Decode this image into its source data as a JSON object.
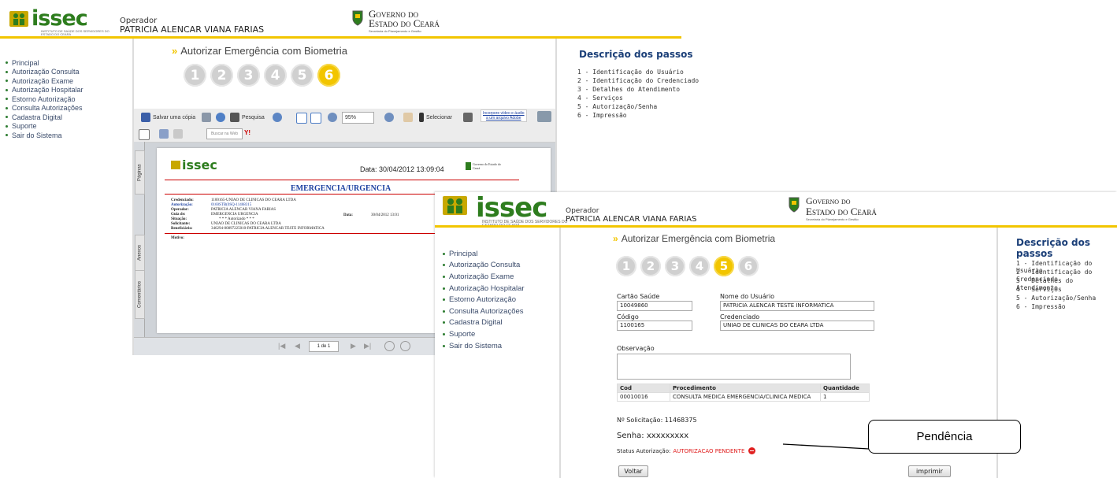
{
  "back_screen": {
    "logo": {
      "text": "issec",
      "subtitle": "INSTITUTO DE SAÚDE DOS SERVIDORES DO ESTADO DO CEARÁ"
    },
    "operator": {
      "label": "Operador",
      "name": "PATRICIA ALENCAR VIANA FARIAS"
    },
    "government": {
      "line1": "Governo do",
      "line2": "Estado do Ceará",
      "sub": "Secretaria do Planejamento e Gestão"
    },
    "menu": [
      "Principal",
      "Autorização Consulta",
      "Autorização Exame",
      "Autorização Hospitalar",
      "Estorno Autorização",
      "Consulta Autorizações",
      "Cadastra Digital",
      "Suporte",
      "Sair do Sistema"
    ],
    "page_title": "Autorizar Emergência com Biometria",
    "steps": [
      "1",
      "2",
      "3",
      "4",
      "5",
      "6"
    ],
    "active_step": 6,
    "desc_title": "Descrição dos passos",
    "desc_steps": [
      "1 - Identificação do Usuário",
      "2 - Identificação do Credenciado",
      "3 - Detalhes do Atendimento",
      "4 - Serviços",
      "5 - Autorização/Senha",
      "6 - Impressão"
    ],
    "pdf_toolbar": {
      "save": "Salvar uma cópia",
      "search": "Pesquisa",
      "zoom": "95%",
      "select": "Selecionar",
      "adobe_line1": "Incorpore vídeo e áudio",
      "adobe_line2": "a um arquivo Adobe",
      "web_search": "Buscar na Web",
      "yahoo": "Y!"
    },
    "pdf_side_tabs": [
      "Páginas",
      "Anexos",
      "Comentários"
    ],
    "pdf_nav": {
      "page": "1 de 1"
    },
    "pdf_doc": {
      "logo": "issec",
      "date": "Data: 30/04/2012 13:09:04",
      "gov": "Governo do Estado do Ceará",
      "heading": "EMERGENCIA/URGENCIA",
      "rows": [
        {
          "label": "Credenciado:",
          "value": "1100165-UNIAO DE CLINICAS DO CEARA LTDA"
        },
        {
          "label": "Autorização:",
          "value": "0160STB(0SQ-11468315"
        },
        {
          "label": "Operador:",
          "value": "PATRICIA ALENCAR VIANA FARIAS"
        },
        {
          "label": "Guia de:",
          "value": "EMERGENCIA URGENCIA"
        },
        {
          "label": "Situação:",
          "value": "* * * Autorizado * * *"
        },
        {
          "label": "Solicitante:",
          "value": "UNIAO DE CLINICAS DO CEARA LTDA"
        },
        {
          "label": "Beneficiário:",
          "value": "346294-00897225010-PATRICIA ALENCAR TESTE INFORMATICA"
        }
      ],
      "date_label": "Data:",
      "date_value": "30/04/2012 13:01",
      "motivo": "Motivo:"
    }
  },
  "front_screen": {
    "logo": {
      "text": "issec",
      "subtitle": "INSTITUTO DE SAÚDE DOS SERVIDORES DO ESTADO DO CEARÁ"
    },
    "operator": {
      "label": "Operador",
      "name": "PATRICIA ALENCAR VIANA FARIAS"
    },
    "government": {
      "line1": "Governo do",
      "line2": "Estado do Ceará",
      "sub": "Secretaria do Planejamento e Gestão"
    },
    "menu": [
      "Principal",
      "Autorização Consulta",
      "Autorização Exame",
      "Autorização Hospitalar",
      "Estorno Autorização",
      "Consulta Autorizações",
      "Cadastra Digital",
      "Suporte",
      "Sair do Sistema"
    ],
    "page_title": "Autorizar Emergência com Biometria",
    "steps": [
      "1",
      "2",
      "3",
      "4",
      "5",
      "6"
    ],
    "active_step": 5,
    "desc_title": "Descrição dos passos",
    "desc_steps": [
      "1 - Identificação do Usuário",
      "2 - Identificação do Credenciado",
      "3 - Detalhes do Atendimento",
      "4 - Serviços",
      "5 - Autorização/Senha",
      "6 - Impressão"
    ],
    "form": {
      "cartao_label": "Cartão Saúde",
      "cartao_value": "10049860",
      "nome_label": "Nome do Usuário",
      "nome_value": "PATRICIA ALENCAR TESTE INFORMATICA",
      "codigo_label": "Código",
      "codigo_value": "1100165",
      "credenciado_label": "Credenciado",
      "credenciado_value": "UNIAO DE CLINICAS DO CEARA LTDA",
      "obs_label": "Observação",
      "obs_value": ""
    },
    "table": {
      "headers": [
        "Cod",
        "Procedimento",
        "Quantidade"
      ],
      "rows": [
        [
          "00010016",
          "CONSULTA MEDICA EMERGENCIA/CLINICA MEDICA",
          "1"
        ]
      ]
    },
    "solicitacao": "Nº Solicitação: 11468375",
    "senha": "Senha: xxxxxxxxx",
    "status_label": "Status Autorização:",
    "status_value": "AUTORIZACAO PENDENTE",
    "back_button": "Voltar",
    "print_button": "imprimir"
  },
  "callout": {
    "text": "Pendência"
  },
  "colors": {
    "accent": "#f2c500",
    "brand_green": "#2e7d1e",
    "title_blue": "#1b3f78",
    "status_red": "#e02020"
  }
}
